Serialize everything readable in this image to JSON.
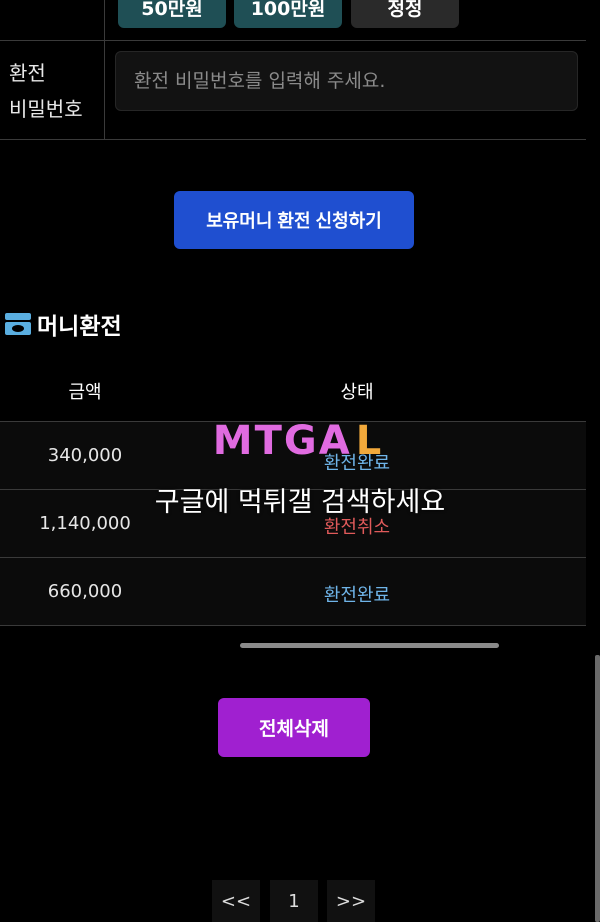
{
  "amount_buttons": [
    {
      "label": "50만원"
    },
    {
      "label": "100만원"
    },
    {
      "label": "정정"
    }
  ],
  "password_row": {
    "label_line1": "환전",
    "label_line2": "비밀번호",
    "placeholder": "환전 비밀번호를 입력해 주세요."
  },
  "apply_button": "보유머니 환전 신청하기",
  "section": {
    "title": "머니환전",
    "icon": "cash-stack-icon"
  },
  "table": {
    "headers": {
      "amount": "금액",
      "status": "상태"
    },
    "rows": [
      {
        "amount": "340,000",
        "status": "환전완료",
        "status_color": "#6fb4e8"
      },
      {
        "amount": "1,140,000",
        "status": "환전취소",
        "status_color": "#e05a5a"
      },
      {
        "amount": "660,000",
        "status": "환전완료",
        "status_color": "#6fb4e8"
      }
    ]
  },
  "watermark": {
    "logo": "MTGA",
    "text": "구글에 먹튀갤 검색하세요"
  },
  "delete_all_button": "전체삭제",
  "pagination": {
    "prev": "<<",
    "current": "1",
    "next": ">>"
  },
  "colors": {
    "apply_button": "#1f4fd0",
    "delete_button": "#a020d0",
    "accent_teal": "#1f4f55"
  }
}
